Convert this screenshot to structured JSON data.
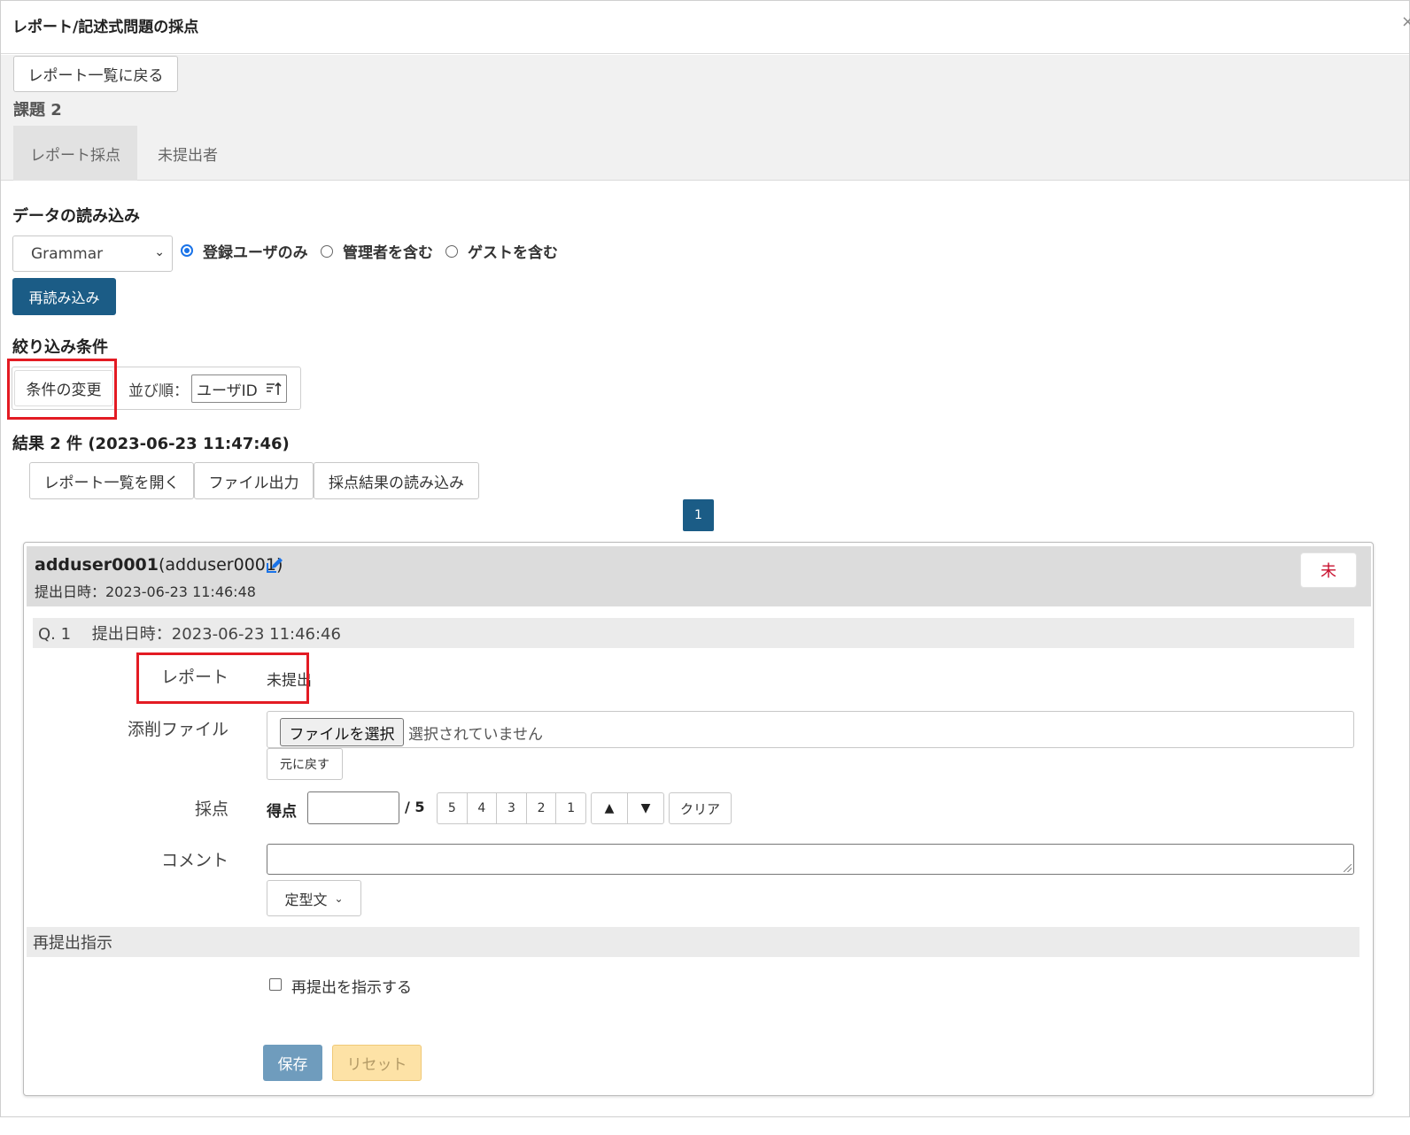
{
  "dialog": {
    "title": "レポート/記述式問題の採点",
    "close_char": "×"
  },
  "nav": {
    "back_label": "レポート一覧に戻る",
    "assignment_title": "課題 2",
    "tabs": [
      {
        "label": "レポート採点",
        "active": true
      },
      {
        "label": "未提出者",
        "active": false
      }
    ]
  },
  "data_load": {
    "heading": "データの読み込み",
    "select_value": "Grammar",
    "radios": [
      {
        "label": "登録ユーザのみ",
        "checked": true
      },
      {
        "label": "管理者を含む",
        "checked": false
      },
      {
        "label": "ゲストを含む",
        "checked": false
      }
    ],
    "reload_label": "再読み込み"
  },
  "filter": {
    "heading": "絞り込み条件",
    "change_label": "条件の変更",
    "sort_label": "並び順：",
    "sort_value": "ユーザID"
  },
  "results": {
    "summary": "結果 2 件 (2023-06-23 11:47:46)",
    "actions": [
      "レポート一覧を開く",
      "ファイル出力",
      "採点結果の読み込み"
    ],
    "current_page": "1"
  },
  "submission": {
    "user_id": "adduser0001",
    "user_name_paren": "(adduser0001)",
    "submitted_at": "提出日時：2023-06-23 11:46:48",
    "status_badge": "未",
    "question": {
      "label": "Q. 1　 提出日時：2023-06-23 11:46:46",
      "report_label": "レポート",
      "report_value": "未提出",
      "correction_label": "添削ファイル",
      "file_button": "ファイルを選択",
      "file_status": "選択されていません",
      "revert_label": "元に戻す",
      "score_label": "採点",
      "score_prefix": "得点",
      "score_value": "",
      "score_max": "/ 5",
      "quick_scores": [
        "5",
        "4",
        "3",
        "2",
        "1"
      ],
      "up_arrow": "▲",
      "down_arrow": "▼",
      "clear_label": "クリア",
      "comment_label": "コメント",
      "comment_value": "",
      "template_label": "定型文"
    },
    "resubmit": {
      "heading": "再提出指示",
      "checkbox_label": "再提出を指示する",
      "checked": false
    },
    "save_label": "保存",
    "reset_label": "リセット"
  },
  "colors": {
    "primary": "#1b5c86",
    "highlight_border": "#e31b23",
    "badge_text": "#c8102e"
  }
}
